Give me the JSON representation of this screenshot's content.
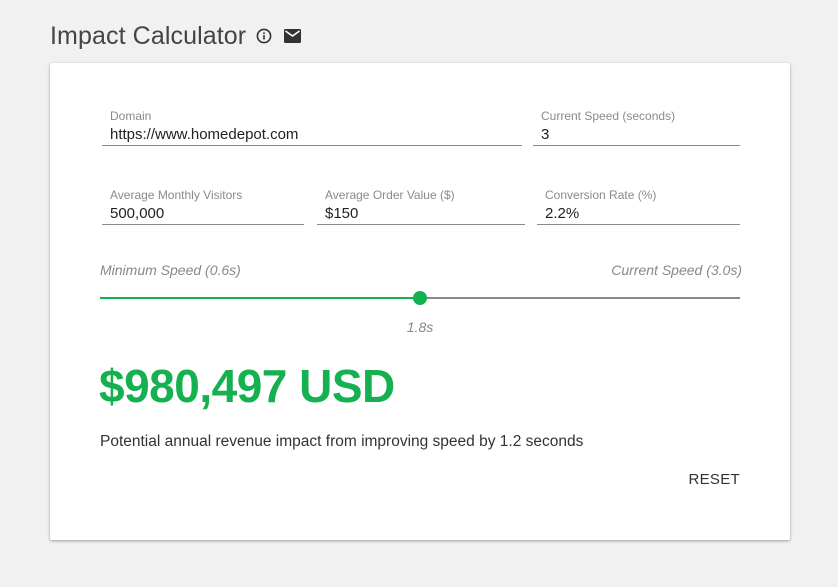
{
  "header": {
    "title": "Impact Calculator",
    "info_icon": "info-icon",
    "mail_icon": "mail-icon"
  },
  "form": {
    "domain": {
      "label": "Domain",
      "value": "https://www.homedepot.com"
    },
    "current_speed": {
      "label": "Current Speed (seconds)",
      "value": "3"
    },
    "monthly_visitors": {
      "label": "Average Monthly Visitors",
      "value": "500,000"
    },
    "order_value": {
      "label": "Average Order Value ($)",
      "value": "$150"
    },
    "conversion_rate": {
      "label": "Conversion Rate (%)",
      "value": "2.2%"
    }
  },
  "slider": {
    "min_label": "Minimum Speed (0.6s)",
    "max_label": "Current Speed (3.0s)",
    "min": 0.6,
    "max": 3.0,
    "value": 1.8,
    "value_label": "1.8s"
  },
  "result": {
    "amount": "$980,497 USD",
    "description": "Potential annual revenue impact from improving speed by 1.2 seconds"
  },
  "actions": {
    "reset_label": "RESET"
  },
  "colors": {
    "accent": "#15b04f",
    "track": "#888888",
    "background": "#f1f1f1",
    "card": "#ffffff"
  }
}
